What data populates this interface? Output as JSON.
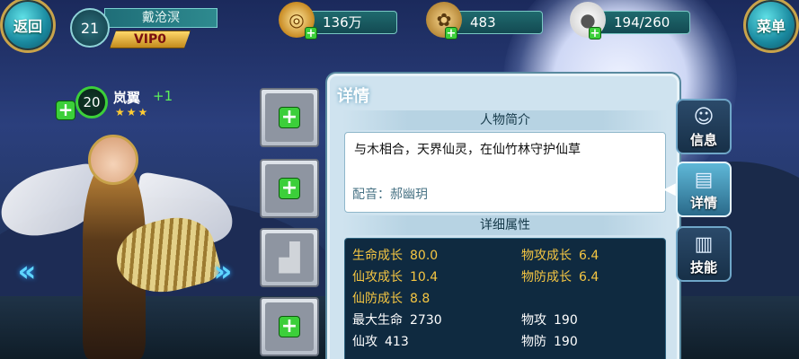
{
  "top": {
    "back_label": "返回",
    "menu_label": "菜单",
    "player_level": "21",
    "player_name": "戴沧溟",
    "vip": "VIP0",
    "resources": [
      {
        "value": "136万",
        "icon": "coin-icon"
      },
      {
        "value": "483",
        "icon": "bag-icon"
      },
      {
        "value": "194/260",
        "icon": "bun-icon"
      }
    ]
  },
  "hero": {
    "level": "20",
    "name": "岚翼",
    "plus": "+1",
    "stars": "★★★"
  },
  "panel": {
    "tab_title": "详情",
    "profile_header": "人物简介",
    "description": "与木相合，天界仙灵，在仙竹林守护仙草",
    "voice": "配音：郝幽玥",
    "attributes_header": "详细属性",
    "growth": [
      {
        "key": "生命成长",
        "value": "80.0"
      },
      {
        "key": "物攻成长",
        "value": "6.4"
      },
      {
        "key": "仙攻成长",
        "value": "10.4"
      },
      {
        "key": "物防成长",
        "value": "6.4"
      },
      {
        "key": "仙防成长",
        "value": "8.8"
      }
    ],
    "stats": [
      {
        "key": "最大生命",
        "value": "2730"
      },
      {
        "key": "物攻",
        "value": "190"
      },
      {
        "key": "仙攻",
        "value": "413"
      },
      {
        "key": "物防",
        "value": "190"
      }
    ]
  },
  "side_tabs": [
    {
      "label": "信息",
      "icon": "person-icon"
    },
    {
      "label": "详情",
      "icon": "scroll-icon"
    },
    {
      "label": "技能",
      "icon": "book-icon"
    }
  ]
}
